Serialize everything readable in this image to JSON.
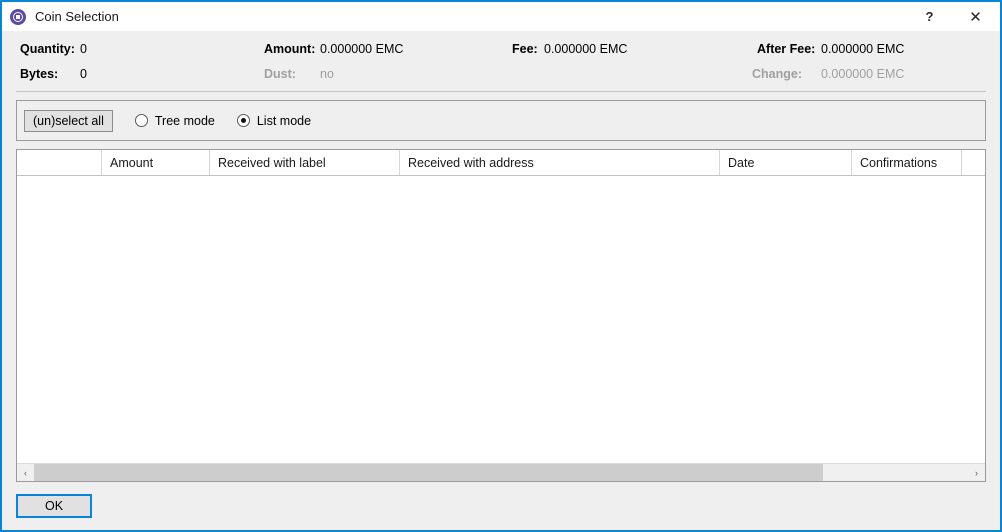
{
  "window": {
    "title": "Coin Selection",
    "app_icon": "coin-logo-icon",
    "accent_color": "#0a84d8",
    "background_color": "#efefef",
    "help_label": "?",
    "close_label": "✕"
  },
  "info": {
    "quantity_label": "Quantity:",
    "quantity_value": "0",
    "bytes_label": "Bytes:",
    "bytes_value": "0",
    "amount_label": "Amount:",
    "amount_value": "0.000000 EMC",
    "dust_label": "Dust:",
    "dust_value": "no",
    "fee_label": "Fee:",
    "fee_value": "0.000000 EMC",
    "after_fee_label": "After Fee:",
    "after_fee_value": "0.000000 EMC",
    "change_label": "Change:",
    "change_value": "0.000000 EMC"
  },
  "toolbar": {
    "select_all_label": "(un)select all",
    "tree_mode_label": "Tree mode",
    "tree_mode_checked": false,
    "list_mode_label": "List mode",
    "list_mode_checked": true
  },
  "table": {
    "columns": [
      {
        "key": "check",
        "label": ""
      },
      {
        "key": "amount",
        "label": "Amount",
        "sort_indicator": "ˇ"
      },
      {
        "key": "label",
        "label": "Received with label"
      },
      {
        "key": "address",
        "label": "Received with address"
      },
      {
        "key": "date",
        "label": "Date"
      },
      {
        "key": "conf",
        "label": "Confirmations"
      },
      {
        "key": "spacer",
        "label": ""
      }
    ],
    "rows": [],
    "row_count": 0
  },
  "scrollbar": {
    "left_arrow": "‹",
    "right_arrow": "›",
    "thumb_fraction": 0.845
  },
  "buttons": {
    "ok_label": "OK"
  }
}
